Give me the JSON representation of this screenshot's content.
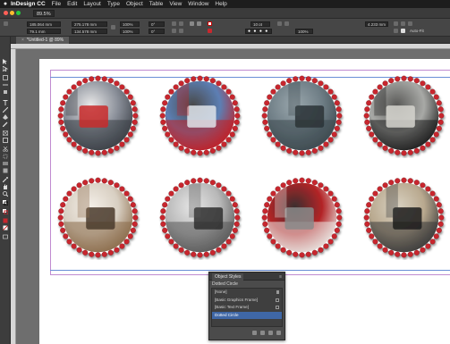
{
  "menubar": {
    "app_name": "InDesign CC",
    "items": [
      "File",
      "Edit",
      "Layout",
      "Type",
      "Object",
      "Table",
      "View",
      "Window",
      "Help"
    ]
  },
  "appbar": {
    "zoom": "89.5%"
  },
  "control_panel": {
    "x_value": "185.064 mm",
    "y_value": "79.1 mm",
    "w_value": "275.178 mm",
    "h_value": "134.578 mm",
    "scale_x": "100%",
    "scale_y": "100%",
    "rotate": "0°",
    "shear": "0°",
    "stroke_weight": "10 pt",
    "stroke_amount": "4.233 mm",
    "opacity": "100%",
    "autofit_label": "Auto-Fit"
  },
  "document_tab": {
    "label": "*Untitled-1 @ 89%",
    "close": "×"
  },
  "frames": [
    {
      "name": "photo-taxi-london",
      "palette": [
        "#8a8f99",
        "#3b3f46",
        "#e8e8e8",
        "#c92a2a"
      ]
    },
    {
      "name": "photo-red-bus",
      "palette": [
        "#5c7fb4",
        "#c21f25",
        "#4a4a4a",
        "#dfe4ea"
      ]
    },
    {
      "name": "photo-foggy-park",
      "palette": [
        "#6f7e86",
        "#3e4a50",
        "#9aa7ad",
        "#2a3236"
      ]
    },
    {
      "name": "photo-black-cabs",
      "palette": [
        "#a8a9a6",
        "#1e1e1e",
        "#5a5a58",
        "#d6d5cf"
      ]
    },
    {
      "name": "photo-coffee-cup",
      "palette": [
        "#d8cfc2",
        "#8b6b4a",
        "#f4efe8",
        "#4a3a2c"
      ]
    },
    {
      "name": "photo-tower-block",
      "palette": [
        "#b8b8b8",
        "#5a5a5a",
        "#e6e6e6",
        "#2e2e2e"
      ]
    },
    {
      "name": "photo-red-bus-interior",
      "palette": [
        "#b32427",
        "#e9e6e2",
        "#3b2f2f",
        "#8a8a8a"
      ]
    },
    {
      "name": "photo-underground-station",
      "palette": [
        "#b9a98f",
        "#3a3a3a",
        "#d9d2c2",
        "#1c1c1c"
      ]
    }
  ],
  "dot_color": "#c8282e",
  "panel": {
    "title": "Object Styles",
    "menu": "≡",
    "current_style": "Dotted Circle",
    "items": [
      "[None]",
      "[Basic Graphics Frame]",
      "[Basic Text Frame]",
      "Dotted Circle"
    ],
    "selected_index": 3
  }
}
